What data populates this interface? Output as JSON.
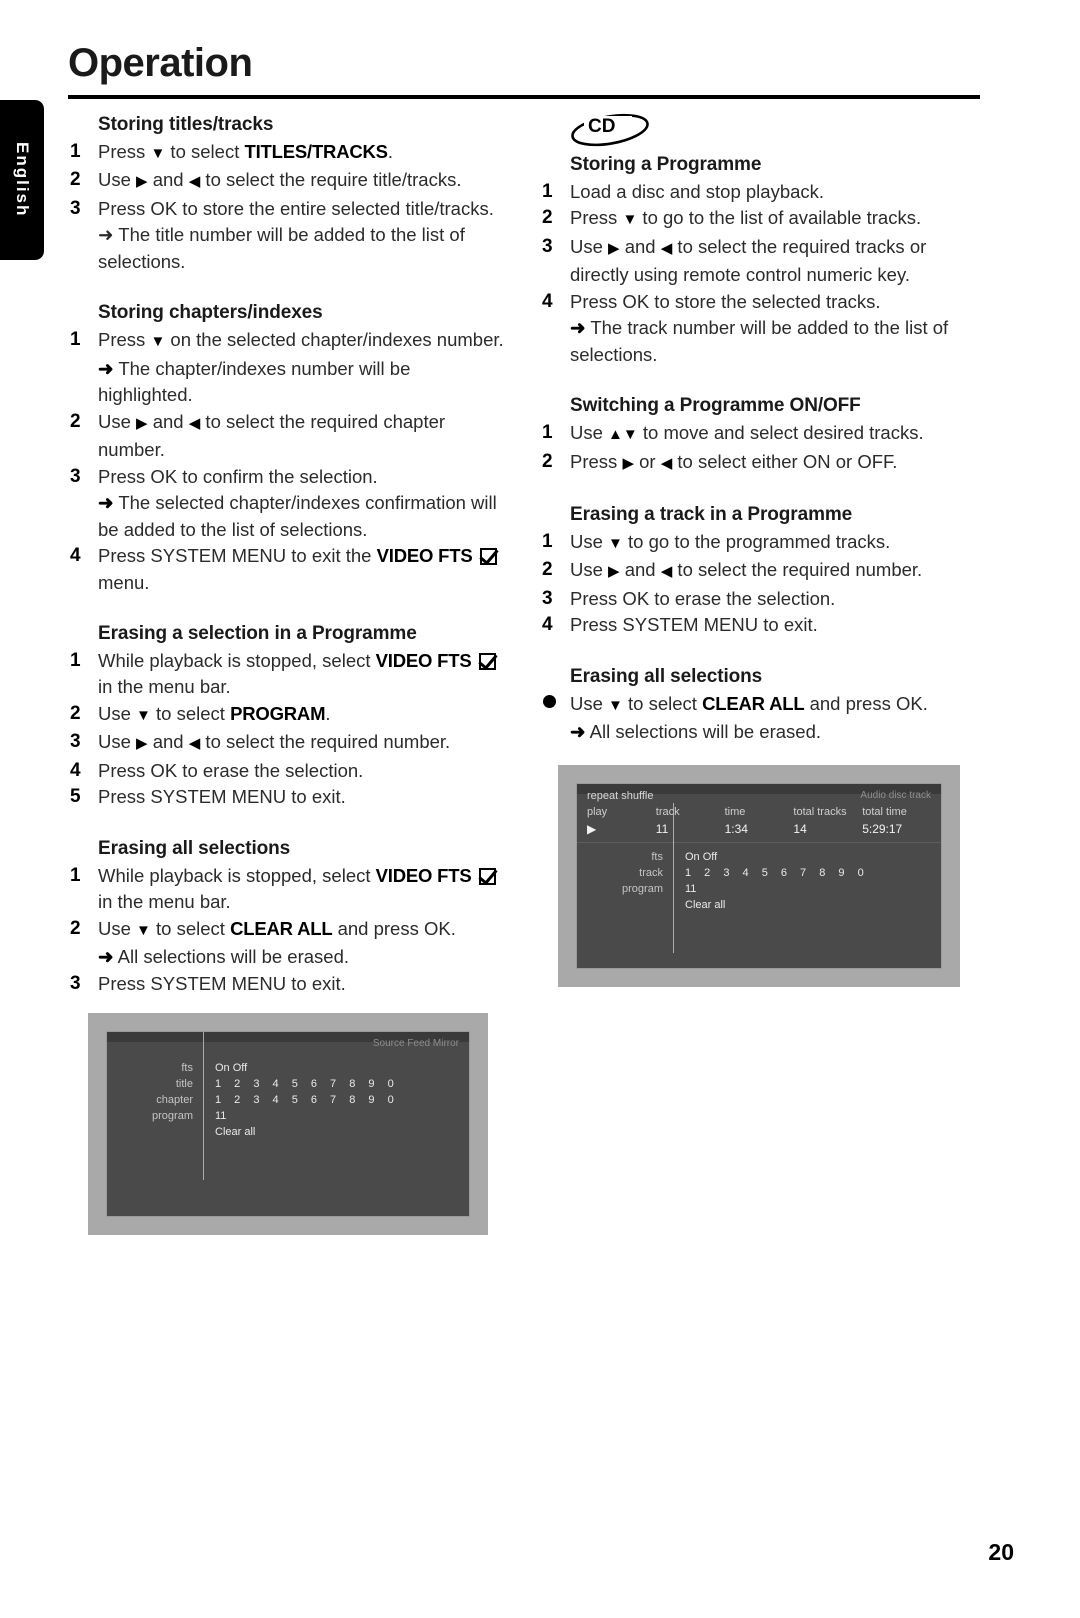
{
  "language_tab": {
    "label": "English"
  },
  "header": {
    "title": "Operation"
  },
  "footer": {
    "page_number": "20"
  },
  "left_column": {
    "sections": [
      {
        "heading": "Storing titles/tracks",
        "steps": [
          {
            "num": "1",
            "html": "Press <span class=\"tri\">▼</span> to select <b>TITLES/TRACKS</b>."
          },
          {
            "num": "2",
            "html": "Use <span class=\"tri\">▶</span> and <span class=\"tri\">◀</span> to select the require title/tracks."
          },
          {
            "num": "3",
            "html": "Press OK to store the entire selected title/tracks."
          }
        ],
        "notes_after": [
          "➜ The title number will be added to the list of selections."
        ]
      },
      {
        "heading": "Storing chapters/indexes",
        "steps": [
          {
            "num": "1",
            "html": "Press <span class=\"tri\">▼</span> on the selected chapter/indexes number.<br><span class=\"arrow\">➜</span> The chapter/indexes number will be highlighted."
          },
          {
            "num": "2",
            "html": "Use <span class=\"tri\">▶</span> and <span class=\"tri\">◀</span> to select the required chapter number."
          },
          {
            "num": "3",
            "html": "Press OK to confirm the selection.<br><span class=\"arrow\">➜</span> The selected chapter/indexes confirmation will be added to the list of selections."
          },
          {
            "num": "4",
            "html": "Press SYSTEM MENU to exit the <b>VIDEO FTS</b> <span class=\"chk\"></span> menu."
          }
        ]
      },
      {
        "heading": "Erasing a selection in a Programme",
        "steps": [
          {
            "num": "1",
            "html": "While playback is stopped, select <b>VIDEO FTS</b> <span class=\"chk\"></span> in the menu bar."
          },
          {
            "num": "2",
            "html": "Use <span class=\"tri\">▼</span> to select <b>PROGRAM</b>."
          },
          {
            "num": "3",
            "html": "Use <span class=\"tri\">▶</span> and <span class=\"tri\">◀</span> to select the required number."
          },
          {
            "num": "4",
            "html": "Press OK to erase the selection."
          },
          {
            "num": "5",
            "html": "Press SYSTEM MENU to exit."
          }
        ]
      },
      {
        "heading": "Erasing all selections",
        "steps": [
          {
            "num": "1",
            "html": "While playback is stopped, select <b>VIDEO FTS</b> <span class=\"chk\"></span> in the menu bar."
          },
          {
            "num": "2",
            "html": "Use <span class=\"tri\">▼</span> to select <b>CLEAR ALL</b> and press OK.<br><span class=\"arrow\">➜</span> All selections will be erased."
          },
          {
            "num": "3",
            "html": "Press SYSTEM MENU to exit."
          }
        ]
      }
    ]
  },
  "right_column": {
    "disc_badge": "CD",
    "sections": [
      {
        "heading": "Storing a Programme",
        "steps": [
          {
            "num": "1",
            "html": "Load a disc and stop playback."
          },
          {
            "num": "2",
            "html": "Press <span class=\"tri\">▼</span> to go to the list of available tracks."
          },
          {
            "num": "3",
            "html": "Use <span class=\"tri\">▶</span> and <span class=\"tri\">◀</span> to select the required tracks or directly using remote control numeric key."
          },
          {
            "num": "4",
            "html": "Press OK to store the selected tracks.<br><span class=\"arrow\">➜</span> The track number will be added to the list of selections."
          }
        ]
      },
      {
        "heading": "Switching a Programme ON/OFF",
        "steps": [
          {
            "num": "1",
            "html": "Use <span class=\"tri\">▲▼</span> to move and select desired tracks."
          },
          {
            "num": "2",
            "html": "Press <span class=\"tri\">▶</span> or <span class=\"tri\">◀</span> to select either ON or OFF."
          }
        ]
      },
      {
        "heading": "Erasing a track in a Programme",
        "steps": [
          {
            "num": "1",
            "html": "Use <span class=\"tri\">▼</span> to go to the programmed tracks."
          },
          {
            "num": "2",
            "html": "Use <span class=\"tri\">▶</span> and <span class=\"tri\">◀</span> to select the required number."
          },
          {
            "num": "3",
            "html": "Press OK to erase the selection."
          },
          {
            "num": "4",
            "html": "Press SYSTEM MENU to exit."
          }
        ]
      },
      {
        "heading": "Erasing all selections",
        "bulleted": true,
        "steps": [
          {
            "num": "●",
            "html": "Use <span class=\"tri\">▼</span> to select <b>CLEAR ALL</b> and press OK.<br><span class=\"arrow\">➜</span> All selections will be erased."
          }
        ]
      }
    ]
  },
  "screenshots": {
    "video_fts": {
      "status_right": "Source Feed Mirror",
      "rows": [
        {
          "label": "fts",
          "values": "On  Off",
          "selected": "On"
        },
        {
          "label": "title",
          "values": "1 2 3 4 5 6 7 8 9 0"
        },
        {
          "label": "chapter",
          "values": "1 2 3 4 5 6 7 8 9 0"
        },
        {
          "label": "program",
          "values": "11"
        },
        {
          "label": "",
          "values": "Clear all"
        }
      ]
    },
    "audio_fts": {
      "top_left": "repeat shuffle",
      "top_right": "Audio disc track",
      "columns": [
        "play",
        "track",
        "time",
        "total tracks",
        "total time"
      ],
      "values": [
        "▶",
        "11",
        "1:34",
        "14",
        "5:29:17"
      ],
      "rows": [
        {
          "label": "fts",
          "values": "On  Off",
          "selected": "On"
        },
        {
          "label": "track",
          "values": "1 2 3 4 5 6 7 8 9 0"
        },
        {
          "label": "program",
          "values": "11"
        },
        {
          "label": "",
          "values": "Clear all"
        }
      ]
    }
  }
}
